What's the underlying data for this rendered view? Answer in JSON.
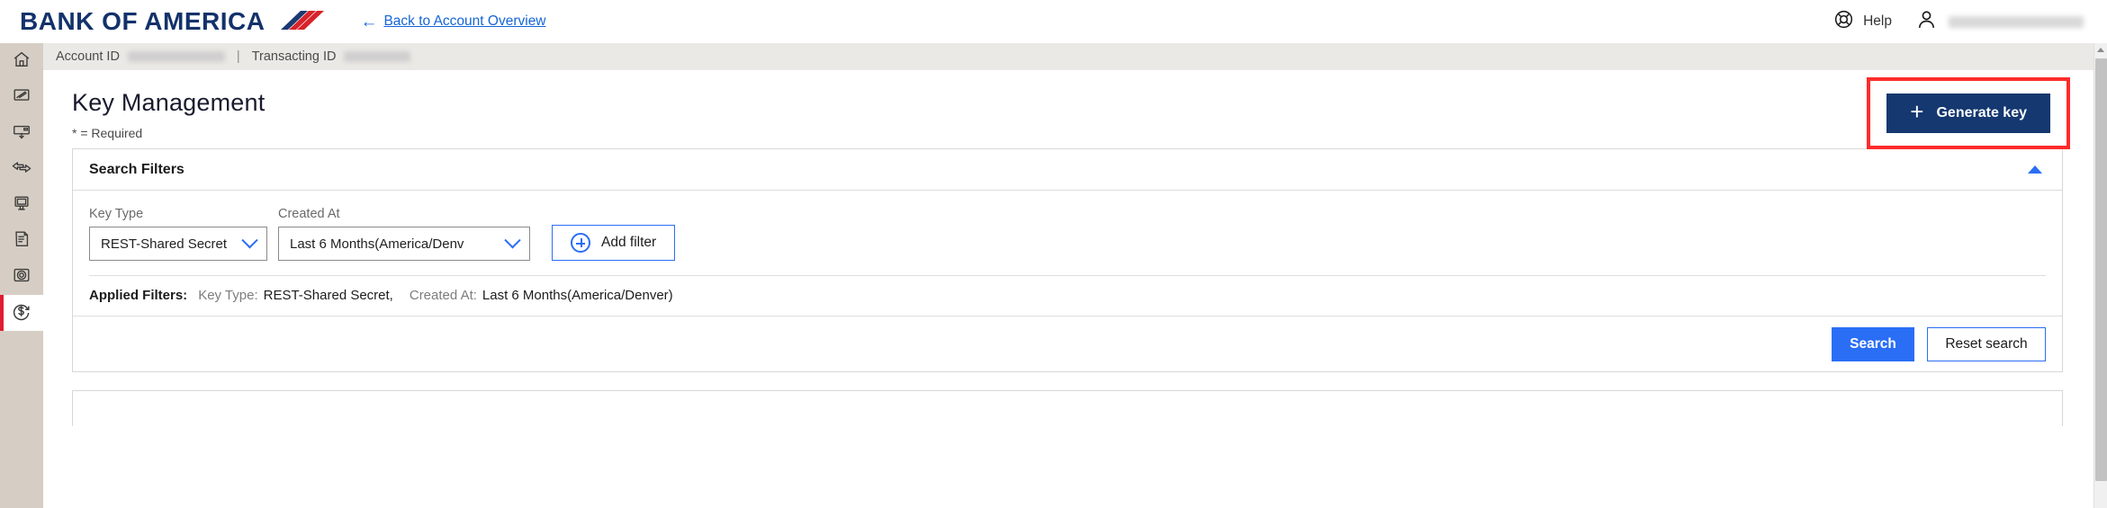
{
  "header": {
    "brand": "BANK OF AMERICA",
    "brand_flag_icon": "bank-of-america-flag-icon",
    "back_link": {
      "label": "Back to Account Overview",
      "arrow_icon": "arrow-left-icon"
    },
    "help": {
      "label": "Help",
      "icon": "life-ring-help-icon"
    },
    "user": {
      "icon": "person-avatar-icon",
      "name": "",
      "redacted": true
    }
  },
  "sidebar": {
    "items": [
      {
        "icon": "home-icon",
        "label": "Home",
        "active": false
      },
      {
        "icon": "laptop-report-icon",
        "label": "Reports",
        "active": false
      },
      {
        "icon": "monitor-download-icon",
        "label": "Downloads",
        "active": false
      },
      {
        "icon": "transfer-arrows-icon",
        "label": "Transfers",
        "active": false
      },
      {
        "icon": "terminal-device-icon",
        "label": "Devices",
        "active": false
      },
      {
        "icon": "document-page-icon",
        "label": "Documents",
        "active": false
      },
      {
        "icon": "target-settings-icon",
        "label": "Settings",
        "active": false
      },
      {
        "icon": "dollar-circle-arrow-icon",
        "label": "Payments",
        "active": true
      }
    ]
  },
  "breadcrumb": {
    "account_id_label": "Account ID",
    "account_id_value": "",
    "separator": "|",
    "transacting_id_label": "Transacting ID",
    "transacting_id_value": ""
  },
  "page": {
    "title": "Key Management",
    "required_note": "* = Required",
    "generate_key_button": {
      "label": "Generate key",
      "icon": "plus-icon",
      "highlight_color": "#ff2b2b",
      "background": "#14386f"
    }
  },
  "search_filters": {
    "title": "Search Filters",
    "collapse_icon": "caret-up-icon",
    "expanded": true,
    "fields": [
      {
        "label": "Key Type",
        "value": "REST-Shared Secret",
        "icon": "chevron-down-icon"
      },
      {
        "label": "Created At",
        "value": "Last 6 Months(America/Denv",
        "icon": "chevron-down-icon"
      }
    ],
    "add_filter": {
      "label": "Add filter",
      "icon": "circle-plus-icon"
    },
    "applied": {
      "title": "Applied Filters:",
      "entries": [
        {
          "key": "Key Type:",
          "value": "REST-Shared Secret,"
        },
        {
          "key": "Created At:",
          "value": "Last 6 Months(America/Denver)"
        }
      ]
    },
    "actions": {
      "search_label": "Search",
      "reset_label": "Reset search",
      "search_color": "#2a6ef5"
    }
  },
  "scrollbar": {
    "up_arrow_icon": "scroll-up-arrow-icon",
    "orientation": "vertical"
  }
}
